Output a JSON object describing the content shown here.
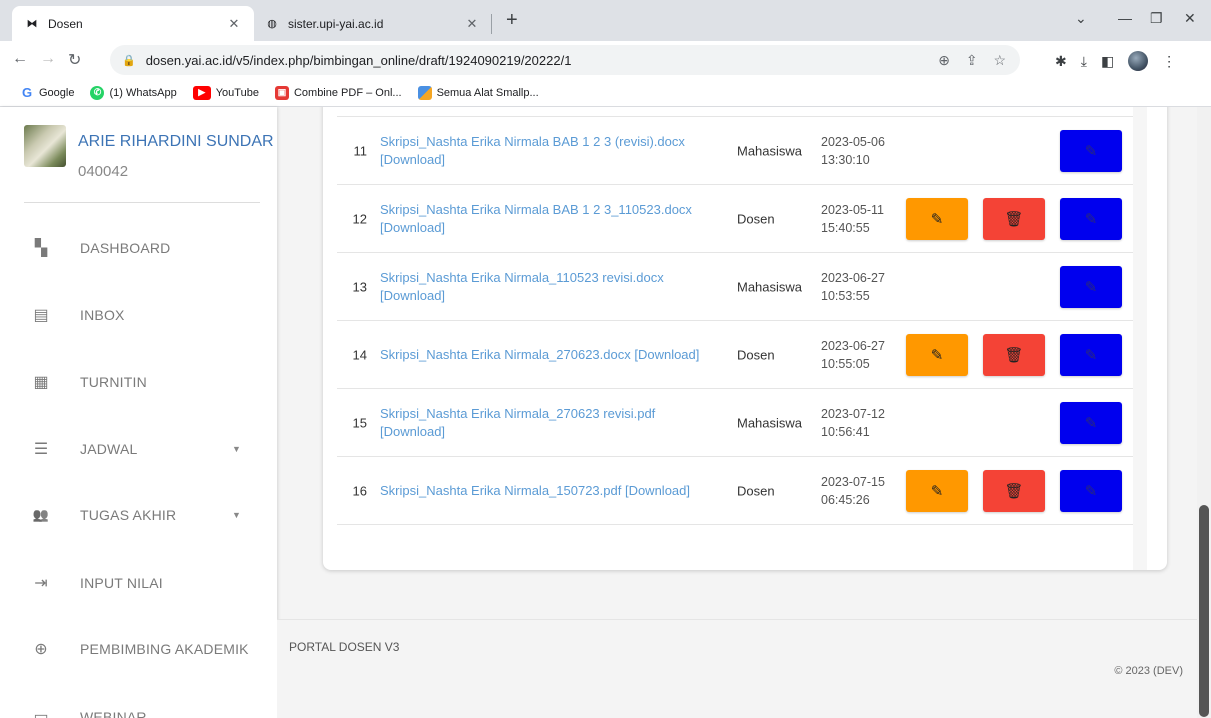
{
  "browser": {
    "tabs": [
      {
        "title": "Dosen",
        "active": true
      },
      {
        "title": "sister.upi-yai.ac.id",
        "active": false
      }
    ],
    "url": "dosen.yai.ac.id/v5/index.php/bimbingan_online/draft/1924090219/20222/1",
    "bookmarks": [
      {
        "label": "Google",
        "icon": "google-icon",
        "color": "#4285f4"
      },
      {
        "label": "(1) WhatsApp",
        "icon": "whatsapp-icon",
        "color": "#25d366"
      },
      {
        "label": "YouTube",
        "icon": "youtube-icon",
        "color": "#ff0000"
      },
      {
        "label": "Combine PDF – Onl...",
        "icon": "pdf-icon",
        "color": "#e53935"
      },
      {
        "label": "Semua Alat Smallp...",
        "icon": "smallpdf-icon",
        "color": "#4a90e2"
      }
    ]
  },
  "sidebar": {
    "user_name": "ARIE RIHARDINI SUNDAR",
    "user_id": "040042",
    "items": [
      {
        "label": "DASHBOARD",
        "icon": "dashboard-icon",
        "glyph": "▚",
        "caret": false
      },
      {
        "label": "INBOX",
        "icon": "inbox-icon",
        "glyph": "▤",
        "caret": false
      },
      {
        "label": "TURNITIN",
        "icon": "turnitin-icon",
        "glyph": "▦",
        "caret": false
      },
      {
        "label": "JADWAL",
        "icon": "list-icon",
        "glyph": "☰",
        "caret": true
      },
      {
        "label": "TUGAS AKHIR",
        "icon": "group-icon",
        "glyph": "👥",
        "caret": true
      },
      {
        "label": "INPUT NILAI",
        "icon": "input-icon",
        "glyph": "⇥",
        "caret": false
      },
      {
        "label": "PEMBIMBING AKADEMIK",
        "icon": "academic-icon",
        "glyph": "⊕",
        "caret": false
      },
      {
        "label": "WEBINAR",
        "icon": "webinar-icon",
        "glyph": "▭",
        "caret": false
      }
    ]
  },
  "table": {
    "rows": [
      {
        "no": "11",
        "file": "Skripsi_Nashta Erika Nirmala BAB 1 2 3 (revisi).docx [Download]",
        "role": "Mahasiswa",
        "date": "2023-05-06",
        "time": "13:30:10",
        "owner_actions": false
      },
      {
        "no": "12",
        "file": "Skripsi_Nashta Erika Nirmala BAB 1 2 3_110523.docx [Download]",
        "role": "Dosen",
        "date": "2023-05-11",
        "time": "15:40:55",
        "owner_actions": true
      },
      {
        "no": "13",
        "file": "Skripsi_Nashta Erika Nirmala_110523 revisi.docx [Download]",
        "role": "Mahasiswa",
        "date": "2023-06-27",
        "time": "10:53:55",
        "owner_actions": false
      },
      {
        "no": "14",
        "file": "Skripsi_Nashta Erika Nirmala_270623.docx [Download]",
        "role": "Dosen",
        "date": "2023-06-27",
        "time": "10:55:05",
        "owner_actions": true
      },
      {
        "no": "15",
        "file": "Skripsi_Nashta Erika Nirmala_270623 revisi.pdf [Download]",
        "role": "Mahasiswa",
        "date": "2023-07-12",
        "time": "10:56:41",
        "owner_actions": false
      },
      {
        "no": "16",
        "file": "Skripsi_Nashta Erika Nirmala_150723.pdf [Download]",
        "role": "Dosen",
        "date": "2023-07-15",
        "time": "06:45:26",
        "owner_actions": true
      }
    ],
    "colors": {
      "edit": "#ff9800",
      "delete": "#f44336",
      "action": "#0000ee"
    }
  },
  "footer": {
    "left": "PORTAL DOSEN V3",
    "right": "© 2023 (DEV)"
  }
}
